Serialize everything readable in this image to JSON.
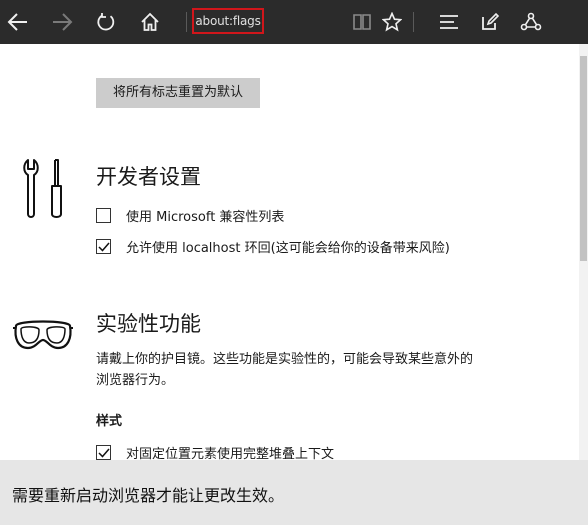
{
  "toolbar": {
    "address": "about:flags",
    "icons": [
      "back-icon",
      "forward-icon",
      "refresh-icon",
      "home-icon",
      "reading-view-icon",
      "favorite-star-icon",
      "hub-icon",
      "web-note-icon",
      "share-icon"
    ]
  },
  "main": {
    "reset_button": "将所有标志重置为默认",
    "sections": [
      {
        "title": "开发者设置",
        "icon": "tools-icon",
        "options": [
          {
            "label": "使用 Microsoft 兼容性列表",
            "checked": false
          },
          {
            "label": "允许使用 localhost 环回(这可能会给你的设备带来风险)",
            "checked": true
          }
        ]
      },
      {
        "title": "实验性功能",
        "icon": "goggles-icon",
        "description": "请戴上你的护目镜。这些功能是实验性的，可能会导致某些意外的浏览器行为。",
        "subheading": "样式",
        "options": [
          {
            "label": "对固定位置元素使用完整堆叠上下文",
            "checked": true
          }
        ]
      }
    ]
  },
  "notification": {
    "text": "需要重新启动浏览器才能让更改生效。"
  },
  "colors": {
    "toolbar_bg": "#2b2b2b",
    "address_highlight": "#d0161b",
    "notification_bg": "#e6e6e6",
    "reset_button_bg": "#cccccc"
  }
}
